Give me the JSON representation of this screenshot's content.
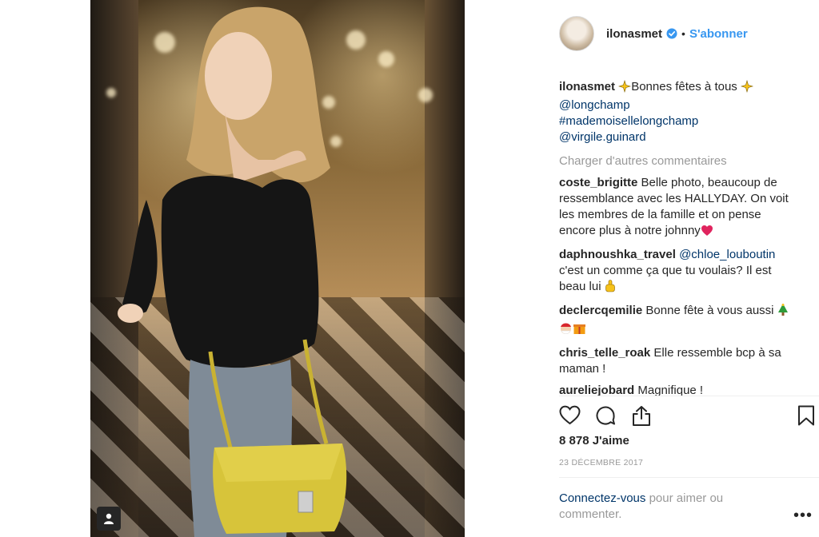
{
  "post": {
    "photo": {
      "alt": "",
      "badge_icon": "user-tag-icon"
    },
    "header": {
      "username": "ilonasmet",
      "separator": "•",
      "follow_label": "S'abonner",
      "verified_icon": "verified-badge-icon"
    },
    "caption": {
      "username": "ilonasmet",
      "text": "Bonnes fêtes à tous",
      "emoji": "sparkles",
      "tags": [
        "@longchamp",
        "#mademoisellelongchamp",
        "@virgile.guinard"
      ]
    },
    "load_more_label": "Charger d'autres commentaires",
    "comments": [
      {
        "user": "coste_brigitte",
        "text": "Belle photo, beaucoup de ressemblance avec les HALLYDAY. On voit les membres de la famille et on pense encore plus à notre johnny",
        "emoji": "heart"
      },
      {
        "user": "daphnoushka_travel",
        "mention": "@chloe_louboutin",
        "text": "c'est un comme ça que tu voulais? Il est beau lui",
        "emoji": "pointing-finger"
      },
      {
        "user": "declercqemilie",
        "text": "Bonne fête à vous aussi",
        "emoji": "christmas-tree santa gift"
      },
      {
        "user": "chris_telle_roak",
        "text": "Elle ressemble bcp à sa maman !"
      },
      {
        "user": "aureliejobard",
        "text": "Magnifique !"
      }
    ],
    "actions": [
      "heart-icon",
      "comment-icon",
      "share-icon",
      "bookmark-icon"
    ],
    "likes_label": "8 878 J'aime",
    "date": "23 DÉCEMBRE 2017",
    "login_prompt": {
      "link": "Connectez-vous",
      "text": "pour aimer ou commenter."
    },
    "more_label": "•••"
  },
  "colors": {
    "accent": "#3897f0",
    "link": "#003569",
    "muted": "#999999",
    "text": "#262626"
  }
}
